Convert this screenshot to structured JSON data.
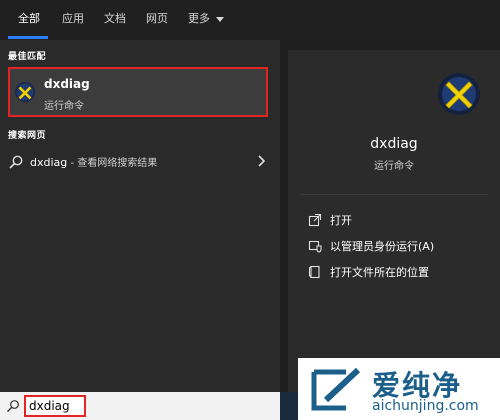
{
  "tabs": [
    {
      "label": "全部",
      "active": true
    },
    {
      "label": "应用",
      "active": false
    },
    {
      "label": "文档",
      "active": false
    },
    {
      "label": "网页",
      "active": false
    },
    {
      "label": "更多",
      "active": false
    }
  ],
  "left": {
    "best_match_header": "最佳匹配",
    "best_match": {
      "title": "dxdiag",
      "subtitle": "运行命令",
      "icon": "dxdiag-icon"
    },
    "web_header": "搜索网页",
    "web_result": {
      "query": "dxdiag",
      "suffix": " - 查看网络搜索结果"
    }
  },
  "detail": {
    "title": "dxdiag",
    "subtitle": "运行命令",
    "actions": [
      {
        "label": "打开",
        "icon": "open-icon"
      },
      {
        "label": "以管理员身份运行(A)",
        "icon": "shield-icon"
      },
      {
        "label": "打开文件所在的位置",
        "icon": "folder-icon"
      }
    ]
  },
  "search": {
    "value": "dxdiag"
  },
  "watermark": {
    "text": "爱纯净",
    "url": "aichunjing.com"
  },
  "colors": {
    "accent": "#2a7fff",
    "highlight": "#e32424",
    "watermark": "#1c5f8a"
  }
}
